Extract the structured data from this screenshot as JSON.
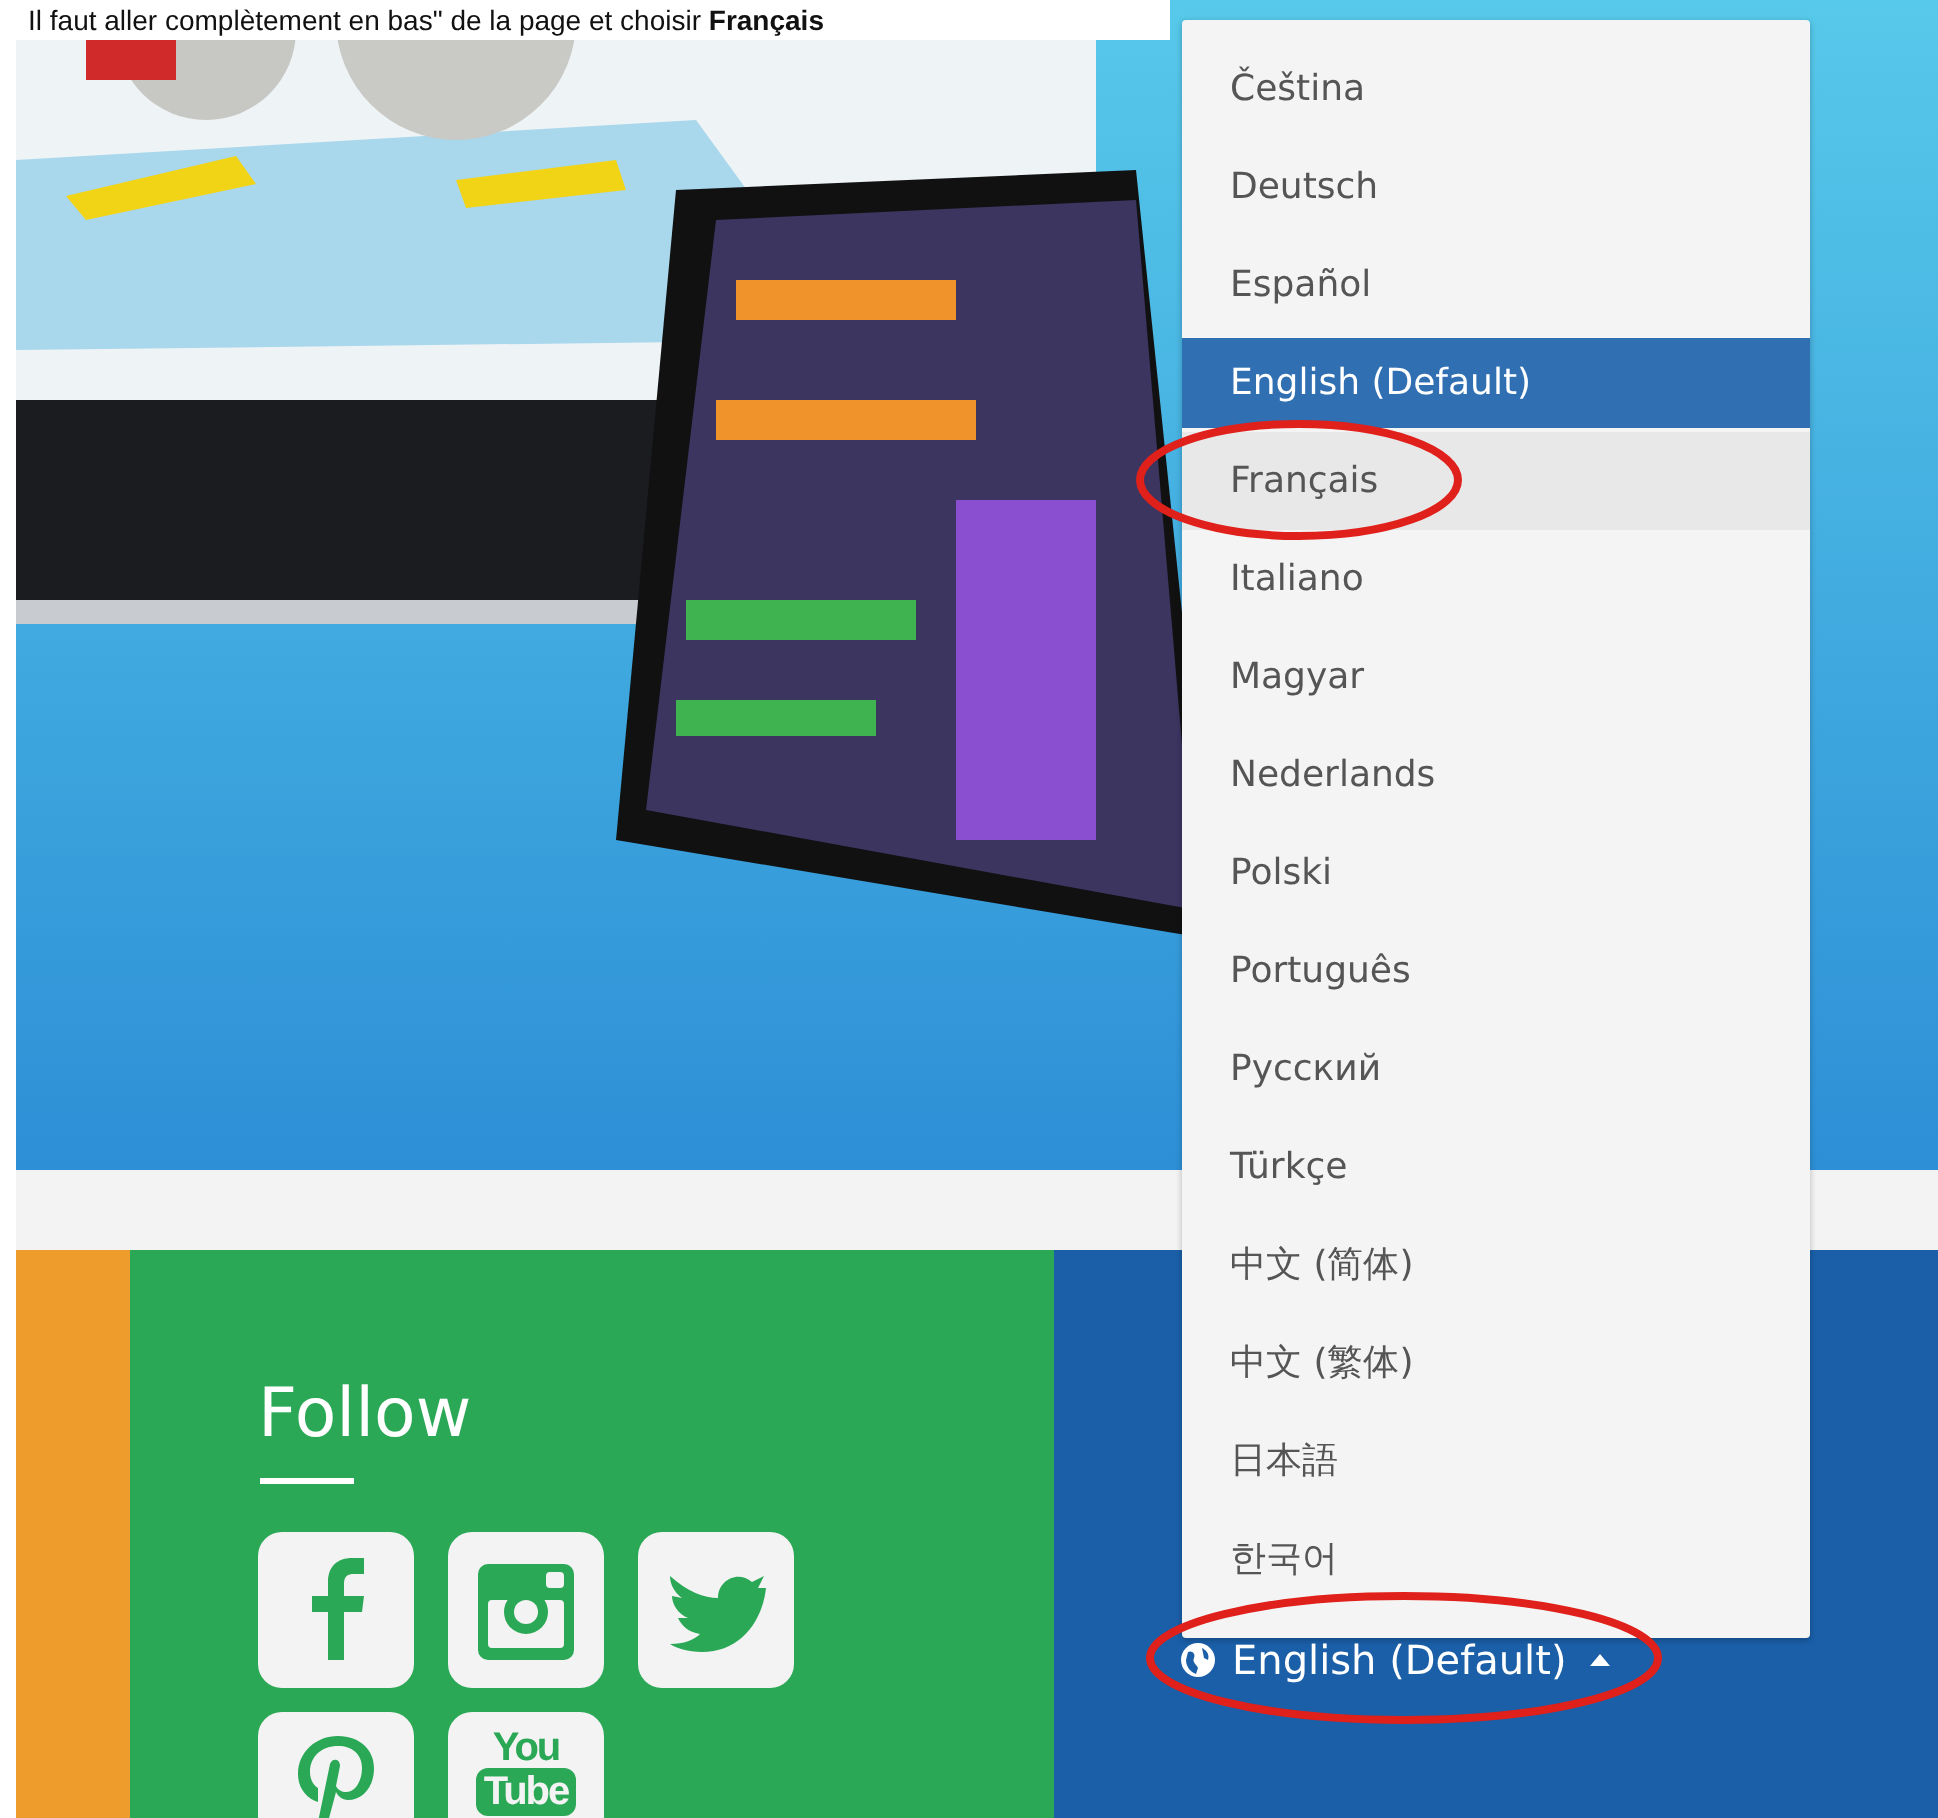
{
  "caption": "Il faut aller complètement en bas\" de la page et choisir **Français**",
  "follow": {
    "title": "Follow",
    "social": [
      {
        "kind": "facebook"
      },
      {
        "kind": "instagram"
      },
      {
        "kind": "twitter"
      },
      {
        "kind": "pinterest"
      },
      {
        "kind": "youtube",
        "text_top": "You",
        "text_bottom": "Tube"
      }
    ]
  },
  "language_menu": {
    "expanded": true,
    "items": [
      {
        "label": "Čeština",
        "selected": false,
        "hovered": false,
        "circled": false
      },
      {
        "label": "Deutsch",
        "selected": false,
        "hovered": false,
        "circled": false
      },
      {
        "label": "Español",
        "selected": false,
        "hovered": false,
        "circled": false
      },
      {
        "label": "English (Default)",
        "selected": true,
        "hovered": false,
        "circled": false
      },
      {
        "label": "Français",
        "selected": false,
        "hovered": true,
        "circled": true
      },
      {
        "label": "Italiano",
        "selected": false,
        "hovered": false,
        "circled": false
      },
      {
        "label": "Magyar",
        "selected": false,
        "hovered": false,
        "circled": false
      },
      {
        "label": "Nederlands",
        "selected": false,
        "hovered": false,
        "circled": false
      },
      {
        "label": "Polski",
        "selected": false,
        "hovered": false,
        "circled": false
      },
      {
        "label": "Português",
        "selected": false,
        "hovered": false,
        "circled": false
      },
      {
        "label": "Русский",
        "selected": false,
        "hovered": false,
        "circled": false
      },
      {
        "label": "Türkçe",
        "selected": false,
        "hovered": false,
        "circled": false
      },
      {
        "label": "中文 (简体)",
        "selected": false,
        "hovered": false,
        "circled": false
      },
      {
        "label": "中文 (繁体)",
        "selected": false,
        "hovered": false,
        "circled": false
      },
      {
        "label": "日本語",
        "selected": false,
        "hovered": false,
        "circled": false
      },
      {
        "label": "한국어",
        "selected": false,
        "hovered": false,
        "circled": false
      }
    ],
    "button": {
      "label": "English (Default)",
      "circled": true
    }
  }
}
